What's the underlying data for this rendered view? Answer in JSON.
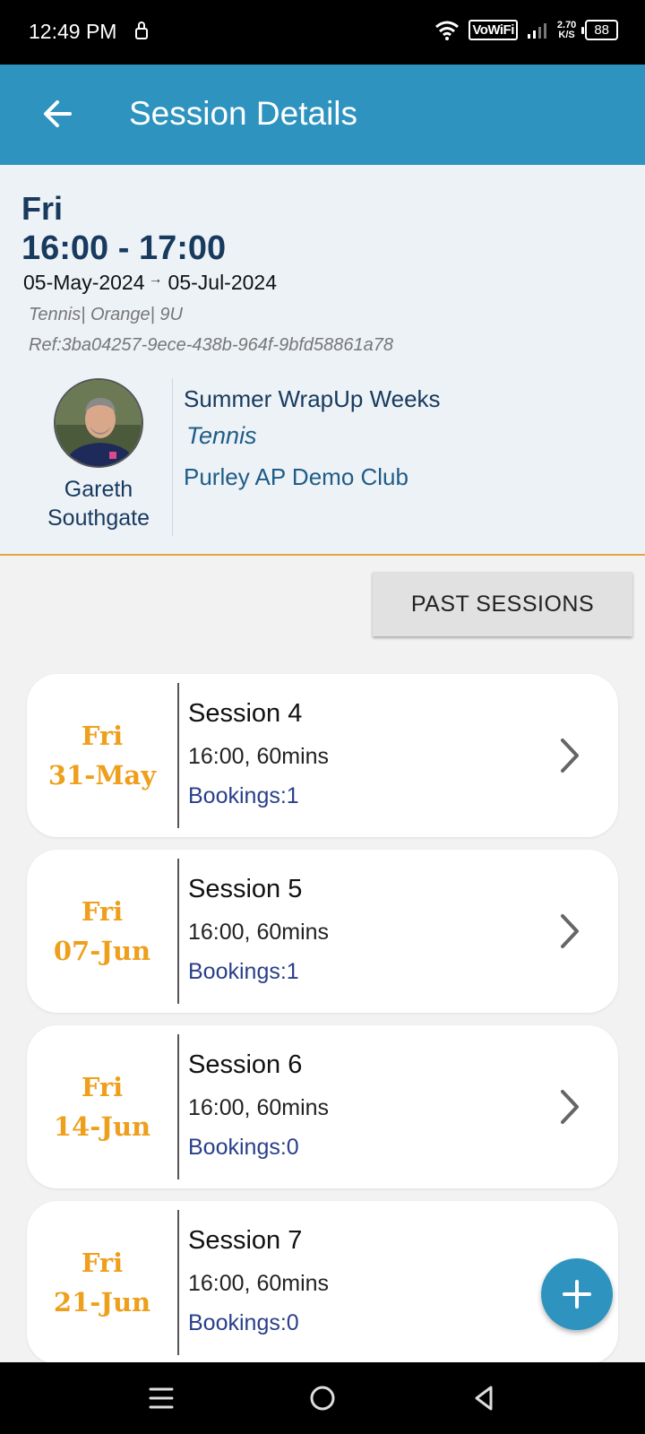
{
  "status_bar": {
    "time": "12:49 PM",
    "vowifi": "VoWiFi",
    "net_speed_value": "2.70",
    "net_speed_unit": "K/S",
    "battery": "88"
  },
  "app_bar": {
    "title": "Session Details",
    "back_icon": "arrow-left-icon"
  },
  "session": {
    "day": "Fri",
    "time_range": "16:00 - 17:00",
    "start_date": "05-May-2024",
    "end_date": "05-Jul-2024",
    "date_arrow": "→",
    "tags": "Tennis| Orange| 9U",
    "ref": "Ref:3ba04257-9ece-438b-964f-9bfd58861a78",
    "coach_first": "Gareth",
    "coach_last": "Southgate",
    "programme": "Summer WrapUp Weeks",
    "sport": "Tennis",
    "club": "Purley AP Demo Club"
  },
  "past_sessions_label": "PAST SESSIONS",
  "sessions": [
    {
      "day": "Fri",
      "date": "31-May",
      "title": "Session 4",
      "time": "16:00, 60mins",
      "bookings": "Bookings:1"
    },
    {
      "day": "Fri",
      "date": "07-Jun",
      "title": "Session 5",
      "time": "16:00, 60mins",
      "bookings": "Bookings:1"
    },
    {
      "day": "Fri",
      "date": "14-Jun",
      "title": "Session 6",
      "time": "16:00, 60mins",
      "bookings": "Bookings:0"
    },
    {
      "day": "Fri",
      "date": "21-Jun",
      "title": "Session 7",
      "time": "16:00, 60mins",
      "bookings": "Bookings:0"
    }
  ],
  "fab_icon": "plus-icon",
  "colors": {
    "app_bar": "#2e94bf",
    "accent_orange": "#ee9f1c",
    "navy_text": "#173a5e",
    "bookings_text": "#283f8a"
  }
}
